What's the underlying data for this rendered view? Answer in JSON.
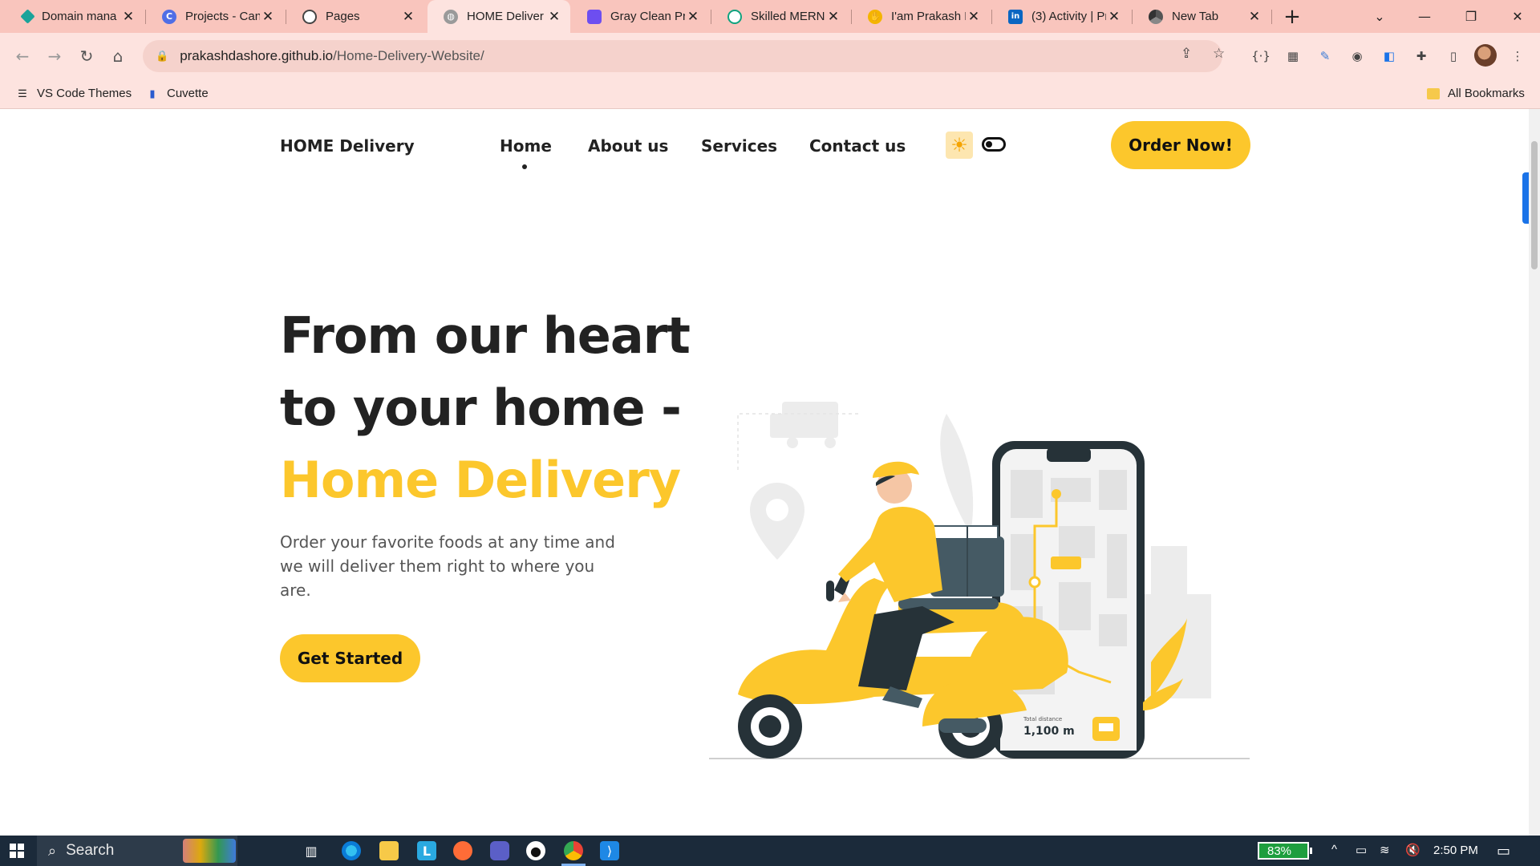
{
  "browser": {
    "tabs": [
      {
        "title": "Domain mana",
        "icon": "diamond-icon",
        "color": "#1aa39a"
      },
      {
        "title": "Projects - Can",
        "icon": "canva-icon",
        "color": "#4f6ee6"
      },
      {
        "title": "Pages",
        "icon": "github-icon",
        "color": "#444444"
      },
      {
        "title": "HOME Deliver",
        "icon": "globe-icon",
        "color": "#888888",
        "active": true
      },
      {
        "title": "Gray Clean Pro",
        "icon": "canva-icon",
        "color": "#6d4ef0"
      },
      {
        "title": "Skilled MERN",
        "icon": "openai-icon",
        "color": "#10a37f"
      },
      {
        "title": "I'am Prakash D",
        "icon": "wave-hand-icon",
        "color": "#f4b400"
      },
      {
        "title": "(3) Activity | Pr",
        "icon": "linkedin-icon",
        "color": "#0a66c2"
      },
      {
        "title": "New Tab",
        "icon": "chrome-icon",
        "color": "#555555"
      }
    ],
    "url_host": "prakashdashore.github.io",
    "url_path": "/Home-Delivery-Website/",
    "bookmarks": [
      {
        "label": "VS Code Themes"
      },
      {
        "label": "Cuvette"
      }
    ],
    "all_bookmarks_label": "All Bookmarks"
  },
  "site": {
    "brand": "HOME Delivery",
    "nav": [
      {
        "label": "Home",
        "active": true
      },
      {
        "label": "About us"
      },
      {
        "label": "Services"
      },
      {
        "label": "Contact us"
      }
    ],
    "order_button": "Order Now!",
    "hero": {
      "line1": "From our heart",
      "line2": "to your home -",
      "line3": "Home Delivery",
      "description": "Order your favorite foods at any time and we will deliver them right to where you are.",
      "cta": "Get Started"
    },
    "illustration": {
      "distance_label": "Total distance",
      "distance_value": "1,100 m"
    },
    "accent_color": "#fcc72c"
  },
  "taskbar": {
    "search_label": "Search",
    "battery": "83%",
    "time": "2:50 PM"
  }
}
